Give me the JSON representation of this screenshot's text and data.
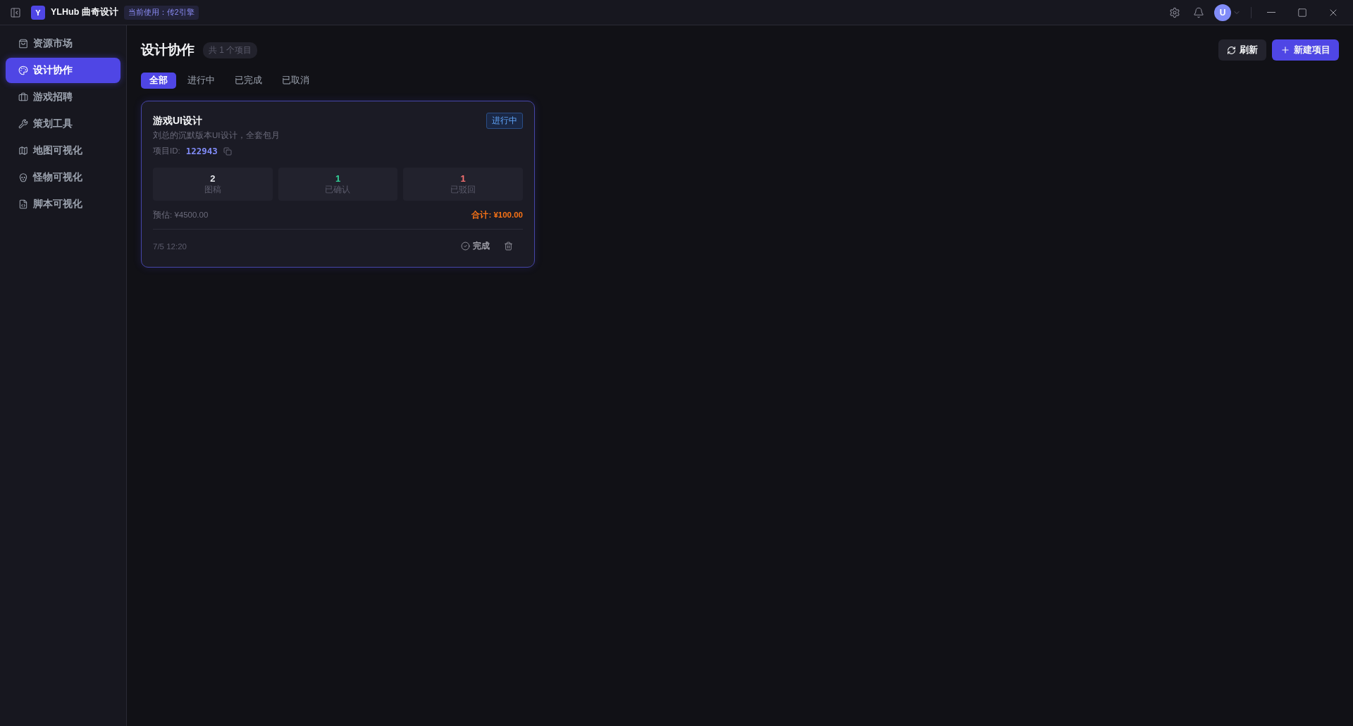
{
  "titlebar": {
    "logo": "Y",
    "app_name": "YLHub 曲奇设计",
    "engine_badge": "当前使用：传2引擎",
    "avatar": "U"
  },
  "sidebar": {
    "items": [
      {
        "label": "资源市场",
        "selected": false
      },
      {
        "label": "设计协作",
        "selected": true
      },
      {
        "label": "游戏招聘",
        "selected": false
      },
      {
        "label": "策划工具",
        "selected": false
      },
      {
        "label": "地图可视化",
        "selected": false
      },
      {
        "label": "怪物可视化",
        "selected": false
      },
      {
        "label": "脚本可视化",
        "selected": false
      }
    ]
  },
  "header": {
    "title": "设计协作",
    "count": "共 1 个项目",
    "refresh_button": "刷新",
    "new_button": "新建项目"
  },
  "tabs": [
    {
      "label": "全部",
      "selected": true
    },
    {
      "label": "进行中",
      "selected": false
    },
    {
      "label": "已完成",
      "selected": false
    },
    {
      "label": "已取消",
      "selected": false
    }
  ],
  "projects": [
    {
      "title": "游戏UI设计",
      "description": "刘总的沉默版本UI设计，全套包月",
      "status": {
        "label": "进行中",
        "kind": "active"
      },
      "id_label": "项目ID:",
      "id": "122943",
      "stats": [
        {
          "value": "2",
          "label": "图稿",
          "color": "#e5e7eb"
        },
        {
          "value": "1",
          "label": "已确认",
          "color": "#34d399"
        },
        {
          "value": "1",
          "label": "已驳回",
          "color": "#f87171"
        }
      ],
      "estimate": "预估: ¥4500.00",
      "total": "合计: ¥100.00",
      "date": "7/5 12:20",
      "complete_button": "完成"
    }
  ]
}
